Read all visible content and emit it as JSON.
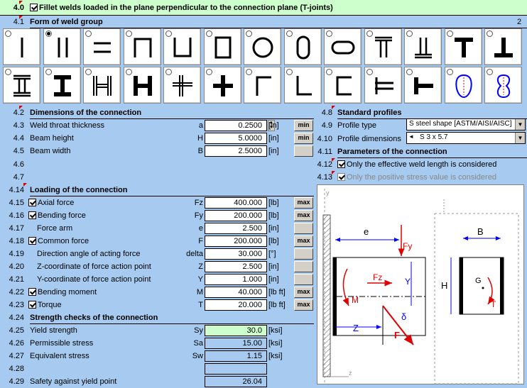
{
  "header": {
    "number": "4.0",
    "title": "Fillet welds loaded in the plane perpendicular to the connection plane (T-joints)",
    "checked": true
  },
  "form_section": {
    "number": "4.1",
    "title": "Form of weld group",
    "selected_value": "2",
    "selected_index": 1
  },
  "weld_forms": [
    "single-vertical",
    "double-vertical",
    "double-horizontal",
    "channel-open-bottom",
    "channel-open-top",
    "rectangle",
    "circle",
    "rounded-vertical",
    "rounded-horizontal",
    "i-beam-thin",
    "t-inverted",
    "t-shape",
    "inverted-t",
    "i-shape",
    "i-beam-wide",
    "h-shape-thin",
    "h-shape-wide",
    "cross-thin",
    "cross-wide",
    "angle-top",
    "angle-bottom",
    "channel-c",
    "double-horizontal-wide",
    "t-sideways",
    "blue-oval",
    "blue-figure8"
  ],
  "dimensions": {
    "number": "4.2",
    "title": "Dimensions of the connection",
    "rows": [
      {
        "num": "4.3",
        "label": "Weld throat thickness",
        "sym": "a",
        "value": "0.2500",
        "unit": "[in]",
        "btn": "min"
      },
      {
        "num": "4.4",
        "label": "Beam height",
        "sym": "H",
        "value": "5.0000",
        "unit": "[in]",
        "btn": "min"
      },
      {
        "num": "4.5",
        "label": "Beam width",
        "sym": "B",
        "value": "2.5000",
        "unit": "[in]",
        "btn": ""
      }
    ]
  },
  "empty_nums": [
    "4.6",
    "4.7"
  ],
  "loading": {
    "number": "4.14",
    "title": "Loading of the connection",
    "rows": [
      {
        "num": "4.15",
        "label": "Axial force",
        "sym": "Fz",
        "value": "400.000",
        "unit": "[lb]",
        "btn": "max",
        "cb": true
      },
      {
        "num": "4.16",
        "label": "Bending force",
        "sym": "Fy",
        "value": "200.000",
        "unit": "[lb]",
        "btn": "max",
        "cb": true
      },
      {
        "num": "4.17",
        "label": "Force arm",
        "sym": "e",
        "value": "2.500",
        "unit": "[in]",
        "btn": ""
      },
      {
        "num": "4.18",
        "label": "Common force",
        "sym": "F",
        "value": "200.000",
        "unit": "[lb]",
        "btn": "max",
        "cb": true
      },
      {
        "num": "4.19",
        "label": "Direction angle of acting force",
        "sym": "delta",
        "value": "30.000",
        "unit": "[°]",
        "btn": ""
      },
      {
        "num": "4.20",
        "label": "Z-coordinate of force action point",
        "sym": "Z",
        "value": "2.500",
        "unit": "[in]",
        "btn": ""
      },
      {
        "num": "4.21",
        "label": "Y-coordinate of force action point",
        "sym": "Y",
        "value": "1.000",
        "unit": "[in]",
        "btn": ""
      },
      {
        "num": "4.22",
        "label": "Bending moment",
        "sym": "M",
        "value": "40.000",
        "unit": "[lb ft]",
        "btn": "max",
        "cb": true
      },
      {
        "num": "4.23",
        "label": "Torque",
        "sym": "T",
        "value": "20.000",
        "unit": "[lb ft]",
        "btn": "max",
        "cb": true
      }
    ]
  },
  "strength": {
    "number": "4.24",
    "title": "Strength checks of the connection",
    "rows": [
      {
        "num": "4.25",
        "label": "Yield strength",
        "sym": "Sy",
        "value": "30.0",
        "unit": "[ksi]"
      },
      {
        "num": "4.26",
        "label": "Permissible stress",
        "sym": "Sa",
        "value": "15.00",
        "unit": "[ksi]"
      },
      {
        "num": "4.27",
        "label": "Equivalent stress",
        "sym": "Sw",
        "value": "1.15",
        "unit": "[ksi]"
      },
      {
        "num": "4.28",
        "label": "",
        "sym": "",
        "value": "",
        "unit": ""
      },
      {
        "num": "4.29",
        "label": "Safety against yield point",
        "sym": "",
        "value": "26.04",
        "unit": ""
      }
    ]
  },
  "profiles": {
    "number": "4.8",
    "title": "Standard profiles",
    "type_num": "4.9",
    "type_label": "Profile type",
    "type_value": "S steel shape  [ASTM/AISI/AISC]",
    "dim_num": "4.10",
    "dim_label": "Profile dimensions",
    "dim_value": "S 3 x 5.7"
  },
  "params": {
    "number": "4.11",
    "title": "Parameters of the connection",
    "opt1_num": "4.12",
    "opt1": "Only the effective weld length is considered",
    "opt2_num": "4.13",
    "opt2": "Only the positive stress value is considered"
  },
  "diagram": {
    "e": "e",
    "Fy": "Fy",
    "Fz": "Fz",
    "Y": "Y",
    "M": "M",
    "Z": "Z",
    "F": "F",
    "delta": "δ",
    "B": "B",
    "H": "H",
    "G": "G",
    "T": "T",
    "axis_y": "y",
    "axis_z": "z"
  }
}
